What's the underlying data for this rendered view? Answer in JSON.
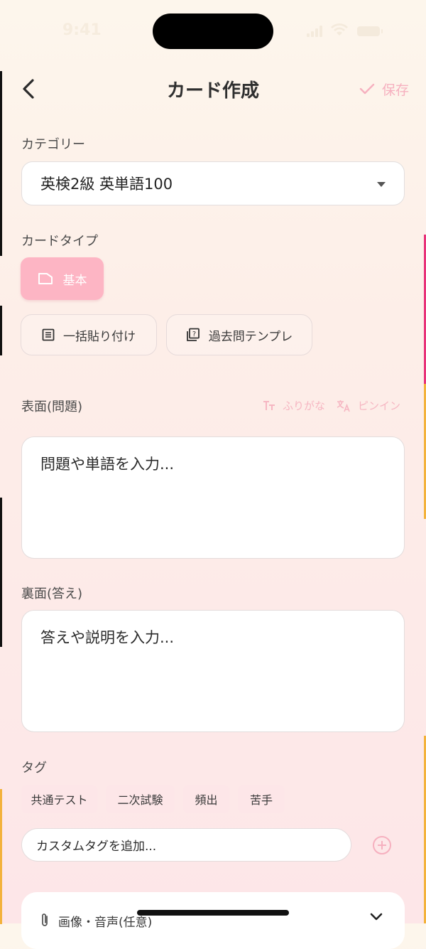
{
  "status_bar": {
    "time": "9:41"
  },
  "header": {
    "title": "カード作成",
    "save_label": "保存"
  },
  "category": {
    "label": "カテゴリー",
    "selected": "英検2級 英単語100"
  },
  "card_type": {
    "label": "カードタイプ",
    "basic": "基本",
    "bulk_paste": "一括貼り付け",
    "past_template": "過去問テンプレ"
  },
  "front": {
    "label": "表面(問題)",
    "furigana": "ふりがな",
    "pinyin": "ピンイン",
    "placeholder": "問題や単語を入力..."
  },
  "back": {
    "label": "裏面(答え)",
    "placeholder": "答えや説明を入力..."
  },
  "tags": {
    "label": "タグ",
    "items": [
      "共通テスト",
      "二次試験",
      "頻出",
      "苦手"
    ],
    "custom_placeholder": "カスタムタグを追加..."
  },
  "attachments": {
    "label": "画像・音声(任意)"
  },
  "colors": {
    "accent": "#fdb5c4",
    "accent_text": "#f6b0bf"
  }
}
